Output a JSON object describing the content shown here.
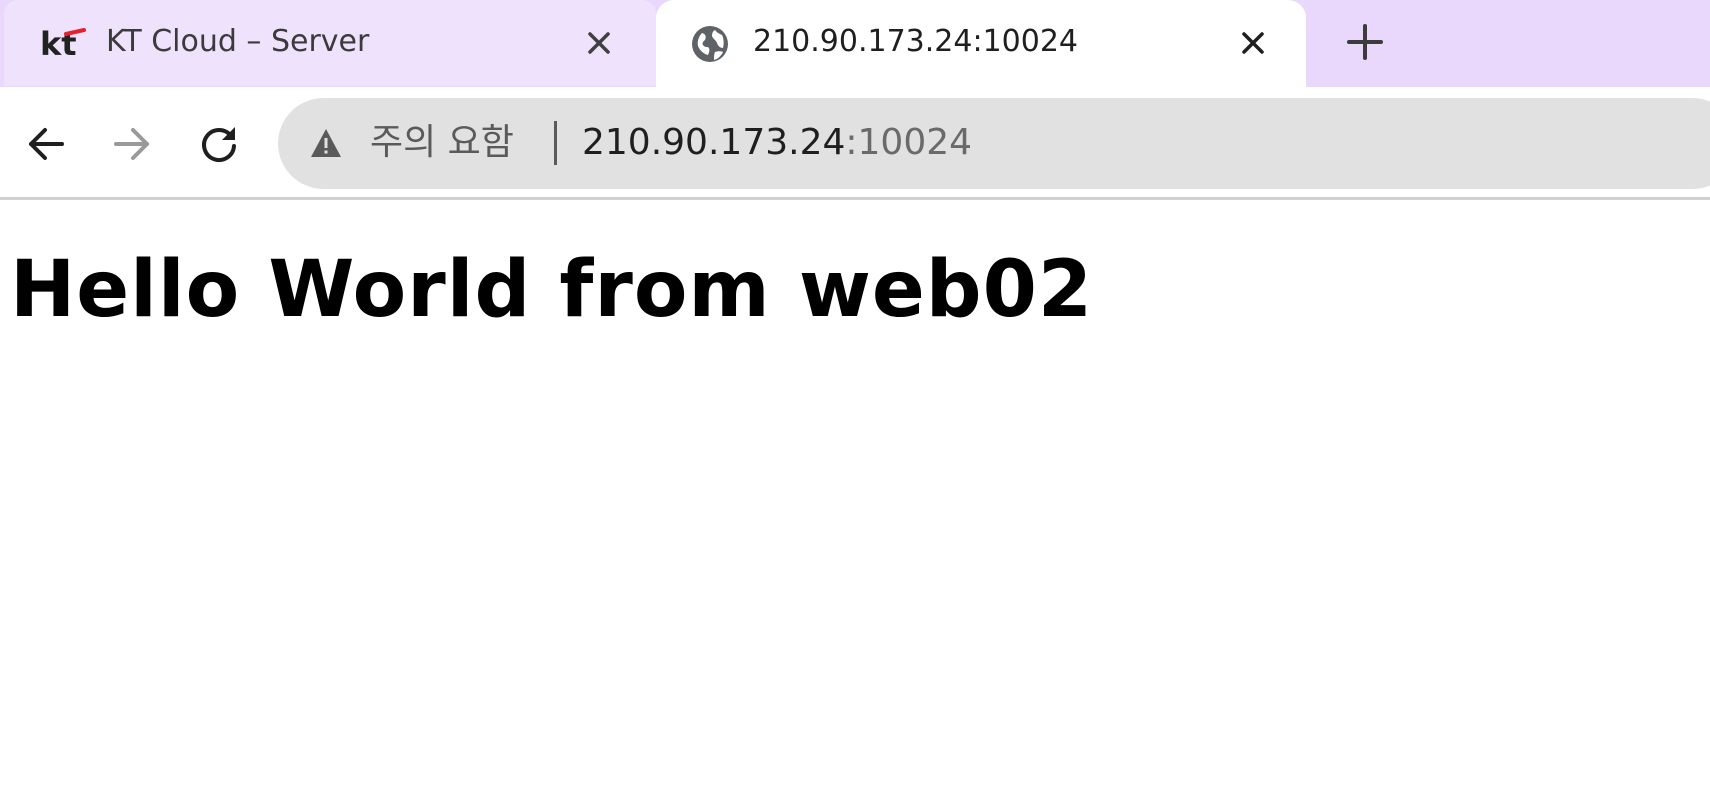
{
  "browser": {
    "tabs": [
      {
        "title": "KT Cloud – Server",
        "favicon": "kt-logo-icon",
        "active": false
      },
      {
        "title": "210.90.173.24:10024",
        "favicon": "globe-icon",
        "active": true
      }
    ],
    "new_tab_icon": "plus-icon",
    "nav": {
      "back_icon": "arrow-left-icon",
      "forward_icon": "arrow-right-icon",
      "reload_icon": "reload-icon"
    },
    "omnibox": {
      "security_icon": "warning-triangle-icon",
      "security_label": "주의 요함",
      "url_host": "210.90.173.24",
      "url_port": ":10024"
    },
    "colors": {
      "tabstrip": "#e9d8fb",
      "omnibox": "#e1e1e1",
      "kt_red": "#e6202e"
    }
  },
  "page": {
    "heading": "Hello World from web02"
  }
}
